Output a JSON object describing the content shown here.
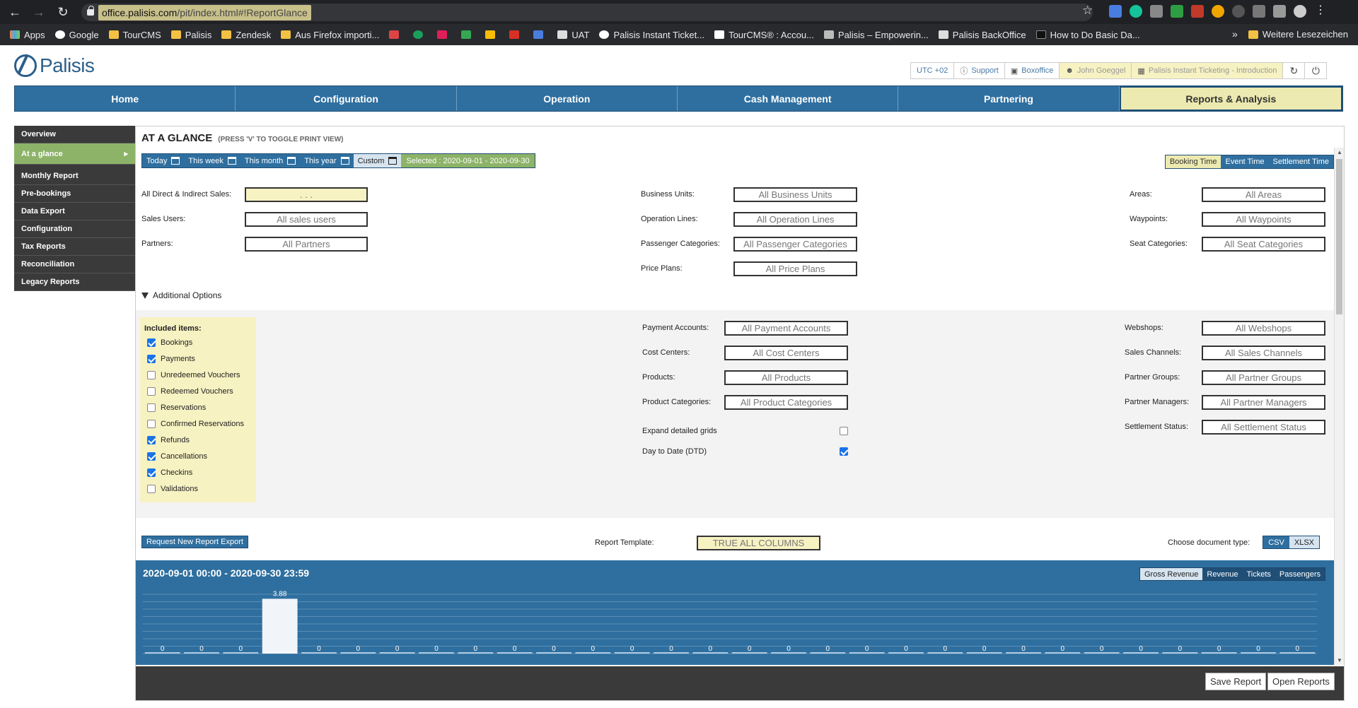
{
  "browser": {
    "url_host": "office.palisis.com",
    "url_path": "/pit/index.html#!ReportGlance",
    "bookmarks": [
      "Apps",
      "Google",
      "TourCMS",
      "Palisis",
      "Zendesk",
      "Aus Firefox importi...",
      "UAT",
      "Palisis Instant Ticket...",
      "TourCMS® : Accou...",
      "Palisis – Empowerin...",
      "Palisis BackOffice",
      "How to Do Basic Da..."
    ],
    "other_bookmarks": "Weitere Lesezeichen"
  },
  "header": {
    "logo": "Palisis",
    "utc": "UTC +02",
    "support": "Support",
    "boxoffice": "Boxoffice",
    "user": "John Goeggel",
    "company": "Palisis Instant Ticketing - Introduction"
  },
  "mainnav": [
    "Home",
    "Configuration",
    "Operation",
    "Cash Management",
    "Partnering",
    "Reports & Analysis"
  ],
  "sidebar": [
    "Overview",
    "At a glance",
    "Monthly Report",
    "Pre-bookings",
    "Data Export",
    "Configuration",
    "Tax Reports",
    "Reconciliation",
    "Legacy Reports"
  ],
  "page": {
    "title": "AT A GLANCE",
    "hint": "(PRESS 'V' TO TOGGLE PRINT VIEW)"
  },
  "datebar": {
    "today": "Today",
    "week": "This week",
    "month": "This month",
    "year": "This year",
    "custom": "Custom",
    "selected": "Selected : 2020-09-01 - 2020-09-30"
  },
  "timebar": [
    "Booking Time",
    "Event Time",
    "Settlement Time"
  ],
  "filters": {
    "sales_label": "All Direct & Indirect Sales:",
    "sales_value": ". . .",
    "users_label": "Sales Users:",
    "users_value": "All sales users",
    "partners_label": "Partners:",
    "partners_value": "All Partners",
    "bu_label": "Business Units:",
    "bu_value": "All Business Units",
    "ol_label": "Operation Lines:",
    "ol_value": "All Operation Lines",
    "pc_label": "Passenger Categories:",
    "pc_value": "All Passenger Categories",
    "pp_label": "Price Plans:",
    "pp_value": "All Price Plans",
    "areas_label": "Areas:",
    "areas_value": "All Areas",
    "wp_label": "Waypoints:",
    "wp_value": "All Waypoints",
    "seat_label": "Seat Categories:",
    "seat_value": "All Seat Categories"
  },
  "additional": {
    "label": "Additional Options",
    "included_title": "Included items:",
    "items": [
      {
        "label": "Bookings",
        "checked": true
      },
      {
        "label": "Payments",
        "checked": true
      },
      {
        "label": "Unredeemed Vouchers",
        "checked": false
      },
      {
        "label": "Redeemed Vouchers",
        "checked": false
      },
      {
        "label": "Reservations",
        "checked": false
      },
      {
        "label": "Confirmed Reservations",
        "checked": false
      },
      {
        "label": "Refunds",
        "checked": true
      },
      {
        "label": "Cancellations",
        "checked": true
      },
      {
        "label": "Checkins",
        "checked": true
      },
      {
        "label": "Validations",
        "checked": false
      }
    ],
    "pa_label": "Payment Accounts:",
    "pa_value": "All Payment Accounts",
    "cc_label": "Cost Centers:",
    "cc_value": "All Cost Centers",
    "pr_label": "Products:",
    "pr_value": "All Products",
    "pcat_label": "Product Categories:",
    "pcat_value": "All Product Categories",
    "expand_label": "Expand detailed grids",
    "dtd_label": "Day to Date (DTD)",
    "ws_label": "Webshops:",
    "ws_value": "All Webshops",
    "sc_label": "Sales Channels:",
    "sc_value": "All Sales Channels",
    "pg_label": "Partner Groups:",
    "pg_value": "All Partner Groups",
    "pm_label": "Partner Managers:",
    "pm_value": "All Partner Managers",
    "ss_label": "Settlement Status:",
    "ss_value": "All Settlement Status"
  },
  "export": {
    "request": "Request New Report Export",
    "template_label": "Report Template:",
    "template_value": "TRUE ALL COLUMNS",
    "doctype_label": "Choose document type:",
    "csv": "CSV",
    "xlsx": "XLSX"
  },
  "chart_header": {
    "range": "2020-09-01 00:00 - 2020-09-30 23:59",
    "metrics": [
      "Gross Revenue",
      "Revenue",
      "Tickets",
      "Passengers"
    ]
  },
  "chart_data": {
    "type": "bar",
    "values": [
      0,
      0,
      0,
      3.88,
      0,
      0,
      0,
      0,
      0,
      0,
      0,
      0,
      0,
      0,
      0,
      0,
      0,
      0,
      0,
      0,
      0,
      0,
      0,
      0,
      0,
      0,
      0,
      0,
      0,
      0
    ],
    "data_labels": [
      "0",
      "0",
      "0",
      "3.88",
      "0",
      "0",
      "0",
      "0",
      "0",
      "0",
      "0",
      "0",
      "0",
      "0",
      "0",
      "0",
      "0",
      "0",
      "0",
      "0",
      "0",
      "0",
      "0",
      "0",
      "0",
      "0",
      "0",
      "0",
      "0",
      "0"
    ],
    "ylim": [
      0,
      4.2
    ],
    "grid": true
  },
  "footer": {
    "save": "Save Report",
    "open": "Open Reports"
  },
  "colors": {
    "primary": "#2f6f9f",
    "accent_yellow": "#eceab0",
    "active_green": "#8cb368"
  }
}
